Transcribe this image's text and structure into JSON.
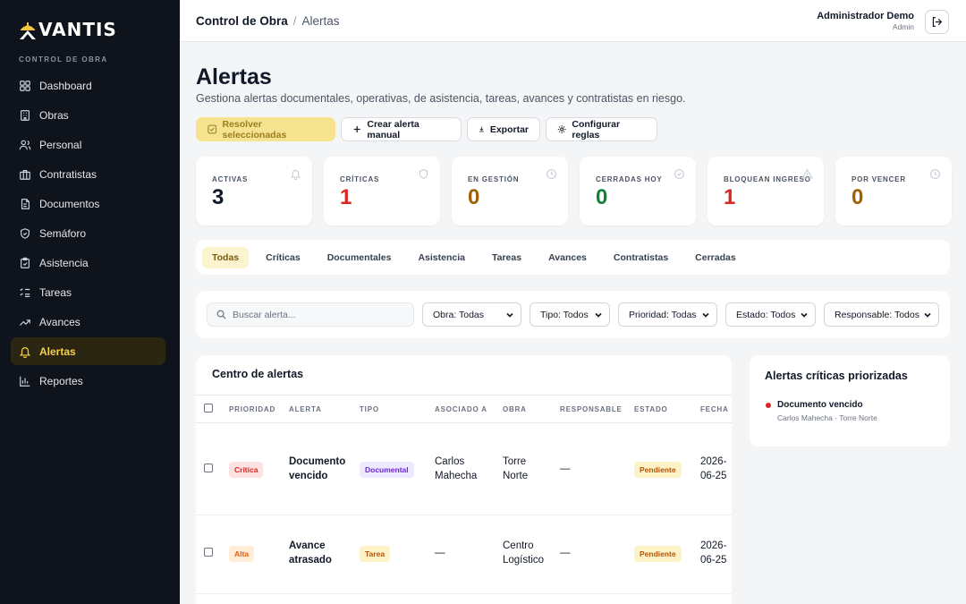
{
  "brand": {
    "logo_text": "VANTIS",
    "section_label": "CONTROL DE OBRA"
  },
  "sidebar": {
    "items": [
      {
        "label": "Dashboard",
        "icon": "grid-icon"
      },
      {
        "label": "Obras",
        "icon": "building-icon"
      },
      {
        "label": "Personal",
        "icon": "users-icon"
      },
      {
        "label": "Contratistas",
        "icon": "briefcase-icon"
      },
      {
        "label": "Documentos",
        "icon": "document-icon"
      },
      {
        "label": "Semáforo",
        "icon": "shield-icon"
      },
      {
        "label": "Asistencia",
        "icon": "clipboard-check-icon"
      },
      {
        "label": "Tareas",
        "icon": "list-checks-icon"
      },
      {
        "label": "Avances",
        "icon": "trending-up-icon"
      },
      {
        "label": "Alertas",
        "icon": "bell-icon",
        "active": true
      },
      {
        "label": "Reportes",
        "icon": "bar-chart-icon"
      }
    ]
  },
  "header": {
    "breadcrumb_root": "Control de Obra",
    "breadcrumb_sep": "/",
    "breadcrumb_current": "Alertas",
    "user_name": "Administrador Demo",
    "user_role": "Admin"
  },
  "page": {
    "title": "Alertas",
    "subtitle": "Gestiona alertas documentales, operativas, de asistencia, tareas, avances y contratistas en riesgo."
  },
  "actions": {
    "resolve": "Resolver seleccionadas",
    "create": "Crear alerta manual",
    "export": "Exportar",
    "config": "Configurar reglas"
  },
  "stats": [
    {
      "label": "ACTIVAS",
      "value": "3",
      "color": "#111827",
      "icon": "bell-icon"
    },
    {
      "label": "CRÍTICAS",
      "value": "1",
      "color": "#dc2626",
      "icon": "shield-icon"
    },
    {
      "label": "EN GESTIÓN",
      "value": "0",
      "color": "#a16207",
      "icon": "clock-icon"
    },
    {
      "label": "CERRADAS HOY",
      "value": "0",
      "color": "#15803d",
      "icon": "check-circle-icon"
    },
    {
      "label": "BLOQUEAN INGRESO",
      "value": "1",
      "color": "#dc2626",
      "icon": "warning-icon"
    },
    {
      "label": "POR VENCER",
      "value": "0",
      "color": "#a16207",
      "icon": "clock-icon"
    }
  ],
  "tabs": [
    "Todas",
    "Críticas",
    "Documentales",
    "Asistencia",
    "Tareas",
    "Avances",
    "Contratistas",
    "Cerradas"
  ],
  "filters": {
    "search_placeholder": "Buscar alerta...",
    "obra": "Obra: Todas",
    "tipo": "Tipo: Todos",
    "prioridad": "Prioridad: Todas",
    "estado": "Estado: Todos",
    "responsable": "Responsable: Todos"
  },
  "table": {
    "title": "Centro de alertas",
    "columns": [
      "PRIORIDAD",
      "ALERTA",
      "TIPO",
      "ASOCIADO A",
      "OBRA",
      "RESPONSABLE",
      "ESTADO",
      "FECHA"
    ],
    "rows": [
      {
        "prioridad": "Crítica",
        "alerta_1": "Documento",
        "alerta_2": "vencido",
        "tipo": "Documental",
        "asociado_1": "Carlos",
        "asociado_2": "Mahecha",
        "obra_1": "Torre",
        "obra_2": "Norte",
        "responsable": "—",
        "estado": "Pendiente",
        "fecha_1": "2026-",
        "fecha_2": "06-25"
      },
      {
        "prioridad": "Alta",
        "alerta_1": "Avance",
        "alerta_2": "atrasado",
        "tipo": "Tarea",
        "asociado_1": "—",
        "asociado_2": "",
        "obra_1": "Centro",
        "obra_2": "Logístico",
        "responsable": "—",
        "estado": "Pendiente",
        "fecha_1": "2026-",
        "fecha_2": "06-25"
      }
    ]
  },
  "priority_panel": {
    "title": "Alertas críticas priorizadas",
    "item_title": "Documento vencido",
    "item_sub": "Carlos Mahecha · Torre Norte"
  }
}
